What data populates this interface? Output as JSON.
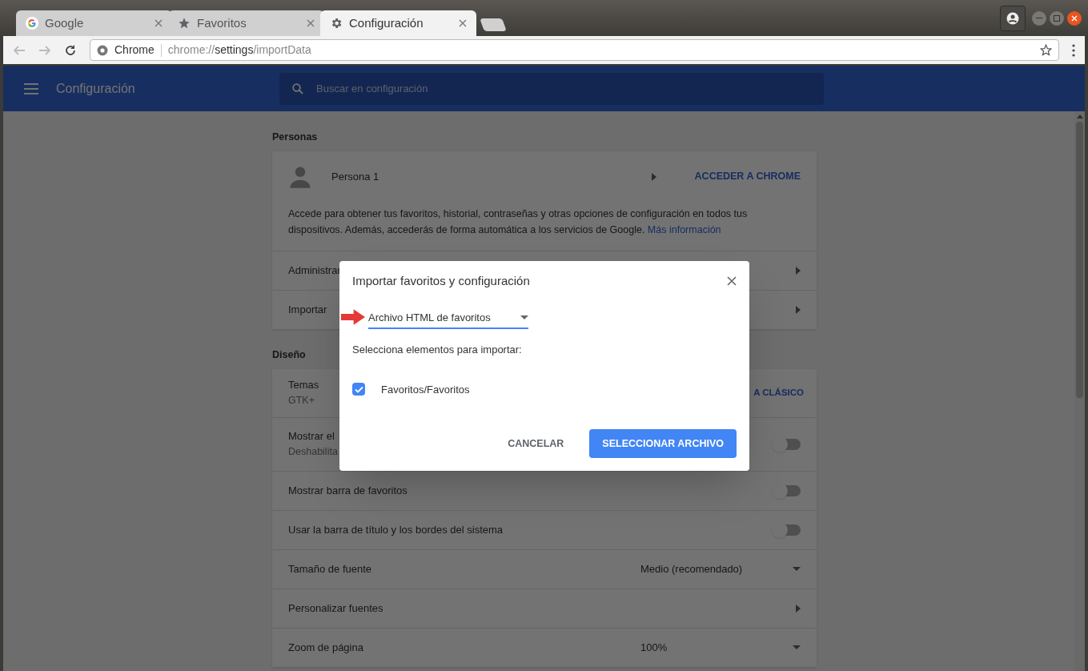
{
  "browser": {
    "tabs": [
      {
        "title": "Google",
        "selected": false
      },
      {
        "title": "Favoritos",
        "selected": false
      },
      {
        "title": "Configuración",
        "selected": true
      }
    ],
    "address": {
      "site_label": "Chrome",
      "scheme": "chrome://",
      "host": "settings",
      "path": "/importData"
    }
  },
  "header": {
    "title": "Configuración",
    "search_placeholder": "Buscar en configuración"
  },
  "sections": [
    {
      "title": "Personas",
      "rows": [
        {
          "kind": "profile",
          "label": "Persona 1",
          "action": "ACCEDER A CHROME"
        },
        {
          "kind": "text",
          "text": "Accede para obtener tus favoritos, historial, contraseñas y otras opciones de configuración en todos tus dispositivos. Además, accederás de forma automática a los servicios de Google.",
          "link": "Más información"
        },
        {
          "kind": "nav",
          "label": "Administrar"
        },
        {
          "kind": "nav",
          "label": "Importar"
        }
      ]
    },
    {
      "title": "Diseño",
      "rows": [
        {
          "kind": "theme",
          "label": "Temas",
          "sublabel": "GTK+",
          "action": "A CLÁSICO"
        },
        {
          "kind": "toggle",
          "label": "Mostrar el",
          "sublabel": "Deshabilita",
          "on": false
        },
        {
          "kind": "toggle",
          "label": "Mostrar barra de favoritos",
          "on": false
        },
        {
          "kind": "toggle",
          "label": "Usar la barra de título y los bordes del sistema",
          "on": false
        },
        {
          "kind": "select",
          "label": "Tamaño de fuente",
          "value": "Medio (recomendado)"
        },
        {
          "kind": "nav",
          "label": "Personalizar fuentes"
        },
        {
          "kind": "select",
          "label": "Zoom de página",
          "value": "100%"
        }
      ]
    }
  ],
  "dialog": {
    "title": "Importar favoritos y configuración",
    "source": "Archivo HTML de favoritos",
    "prompt": "Selecciona elementos para importar:",
    "items": [
      {
        "label": "Favoritos/Favoritos",
        "checked": true
      }
    ],
    "buttons": [
      {
        "label": "CANCELAR",
        "kind": "text"
      },
      {
        "label": "SELECCIONAR ARCHIVO",
        "kind": "primary"
      }
    ]
  }
}
